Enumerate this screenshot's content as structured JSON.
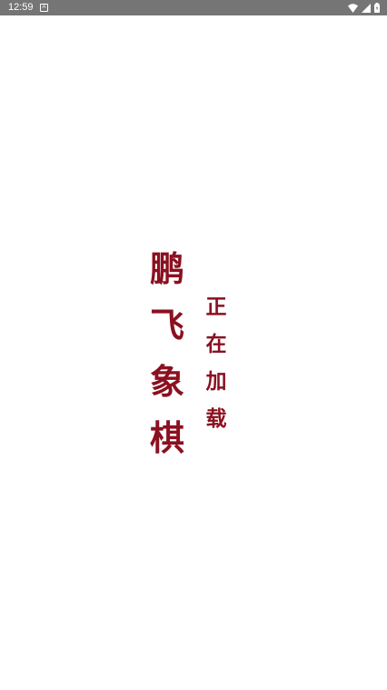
{
  "status_bar": {
    "time": "12:59",
    "notification_icon": "a-notification-icon",
    "icons": [
      "wifi-icon",
      "cell-signal-icon",
      "battery-icon"
    ]
  },
  "splash": {
    "title_chars": [
      "鹏",
      "飞",
      "象",
      "棋"
    ],
    "loading_chars": [
      "正",
      "在",
      "加",
      "载"
    ]
  },
  "colors": {
    "status_bar": "#757575",
    "text_accent": "#8b1020",
    "background": "#ffffff"
  }
}
